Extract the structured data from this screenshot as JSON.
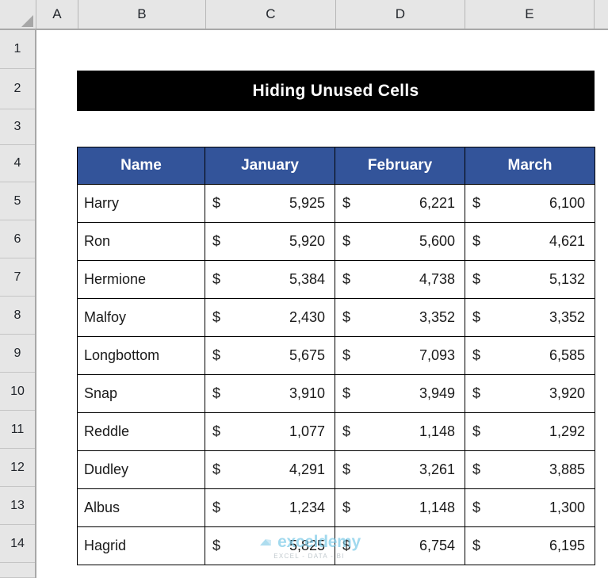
{
  "app": {
    "type": "spreadsheet",
    "column_headers": [
      "A",
      "B",
      "C",
      "D",
      "E"
    ],
    "row_headers": [
      "1",
      "2",
      "3",
      "4",
      "5",
      "6",
      "7",
      "8",
      "9",
      "10",
      "11",
      "12",
      "13",
      "14"
    ],
    "select_all_icon": "select-all-triangle"
  },
  "title_banner": {
    "text": "Hiding Unused Cells",
    "background_color": "#000000",
    "text_color": "#FFFFFF"
  },
  "table": {
    "header_background": "#33549A",
    "header_text_color": "#FFFFFF",
    "columns": [
      "Name",
      "January",
      "February",
      "March"
    ],
    "currency_symbol": "$",
    "rows": [
      {
        "name": "Harry",
        "january": "5,925",
        "february": "6,221",
        "march": "6,100"
      },
      {
        "name": "Ron",
        "january": "5,920",
        "february": "5,600",
        "march": "4,621"
      },
      {
        "name": "Hermione",
        "january": "5,384",
        "february": "4,738",
        "march": "5,132"
      },
      {
        "name": "Malfoy",
        "january": "2,430",
        "february": "3,352",
        "march": "3,352"
      },
      {
        "name": "Longbottom",
        "january": "5,675",
        "february": "7,093",
        "march": "6,585"
      },
      {
        "name": "Snap",
        "january": "3,910",
        "february": "3,949",
        "march": "3,920"
      },
      {
        "name": "Reddle",
        "january": "1,077",
        "february": "1,148",
        "march": "1,292"
      },
      {
        "name": "Dudley",
        "january": "4,291",
        "february": "3,261",
        "march": "3,885"
      },
      {
        "name": "Albus",
        "january": "1,234",
        "february": "1,148",
        "march": "1,300"
      },
      {
        "name": "Hagrid",
        "january": "5,825",
        "february": "6,754",
        "march": "6,195"
      }
    ]
  },
  "watermark": {
    "brand": "exceldemy",
    "tagline": "EXCEL - DATA - BI",
    "brand_color": "#7ECBE8"
  }
}
